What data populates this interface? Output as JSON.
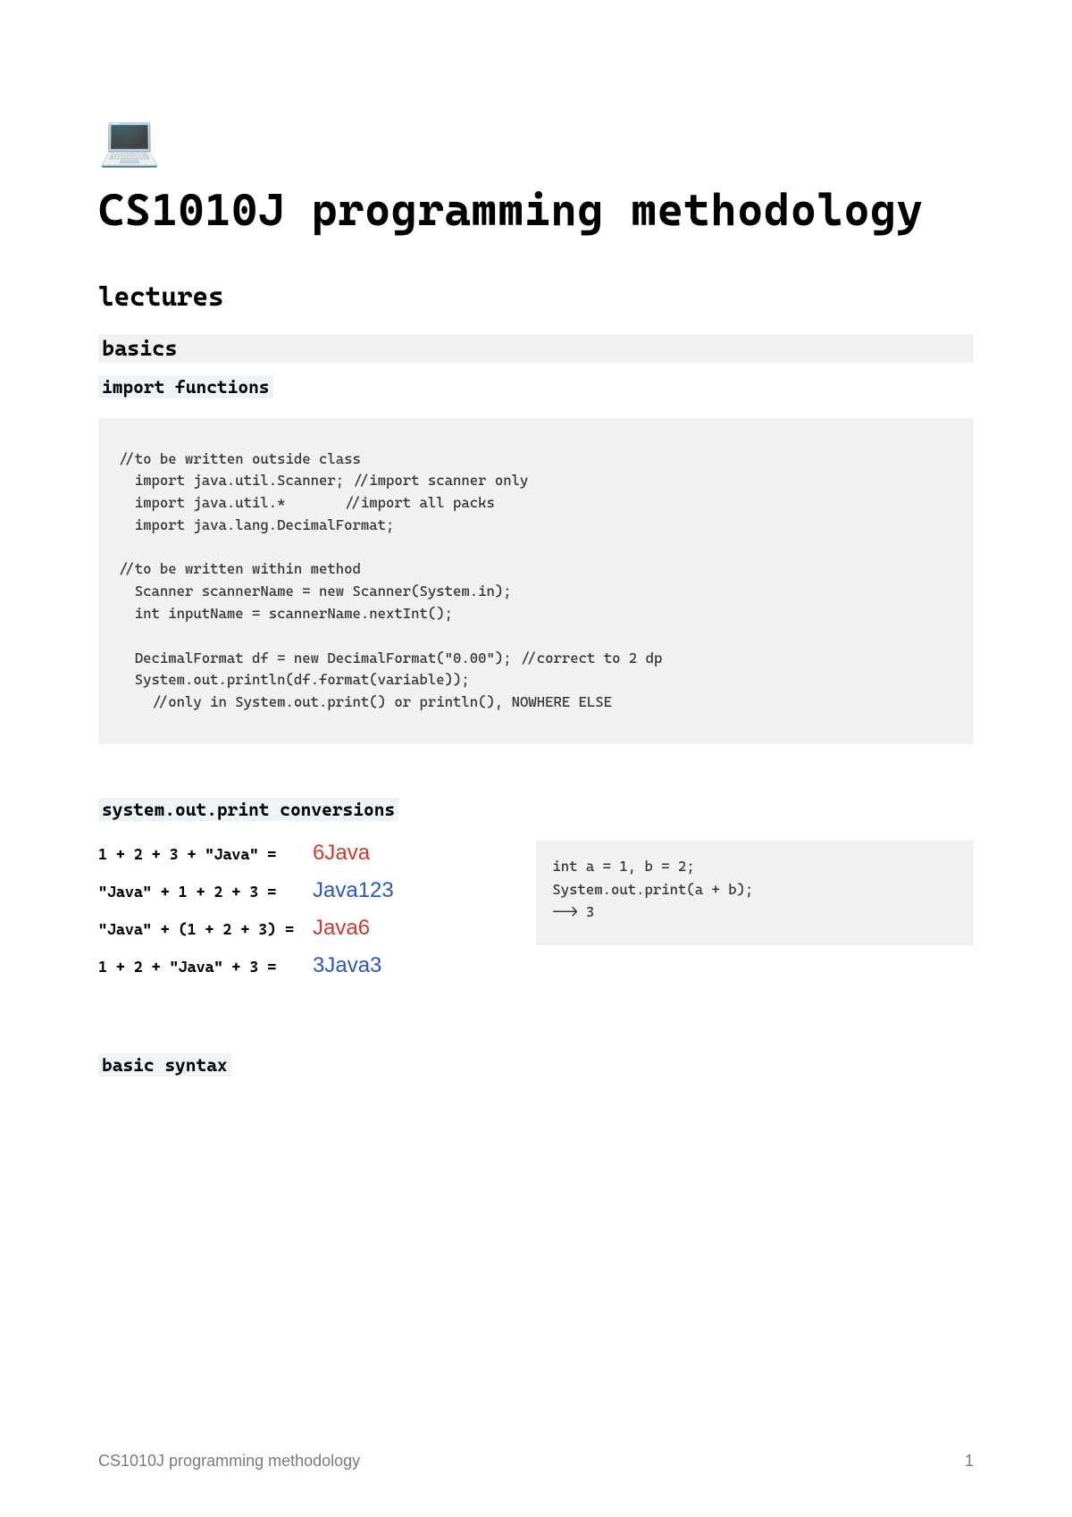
{
  "icon": "💻",
  "title": "CS1010J programming methodology",
  "sections": {
    "lectures": "lectures",
    "basics": "basics",
    "import_functions": "import functions",
    "conversions": "system.out.print conversions",
    "basic_syntax": "basic syntax"
  },
  "code": {
    "imports": "//to be written outside class\n  import java.util.Scanner; //import scanner only\n  import java.util.*       //import all packs\n  import java.lang.DecimalFormat;\n\n//to be written within method\n  Scanner scannerName = new Scanner(System.in);\n  int inputName = scannerName.nextInt();\n\n  DecimalFormat df = new DecimalFormat(\"0.00\"); //correct to 2 dp\n  System.out.println(df.format(variable));\n    //only in System.out.print() or println(), NOWHERE ELSE",
    "small": "int a = 1, b = 2;\nSystem.out.print(a + b);\n--> 3"
  },
  "conversions": [
    {
      "expr": "1 + 2 + 3 + \"Java\" =",
      "result": "6Java",
      "color": "red"
    },
    {
      "expr": "\"Java\" + 1 + 2 + 3 =",
      "result": "Java123",
      "color": "blue"
    },
    {
      "expr": "\"Java\" + (1 + 2 + 3) =",
      "result": "Java6",
      "color": "red"
    },
    {
      "expr": "1 + 2 + \"Java\" + 3 =",
      "result": "3Java3",
      "color": "blue"
    }
  ],
  "footer": {
    "left": "CS1010J programming methodology",
    "right": "1"
  }
}
